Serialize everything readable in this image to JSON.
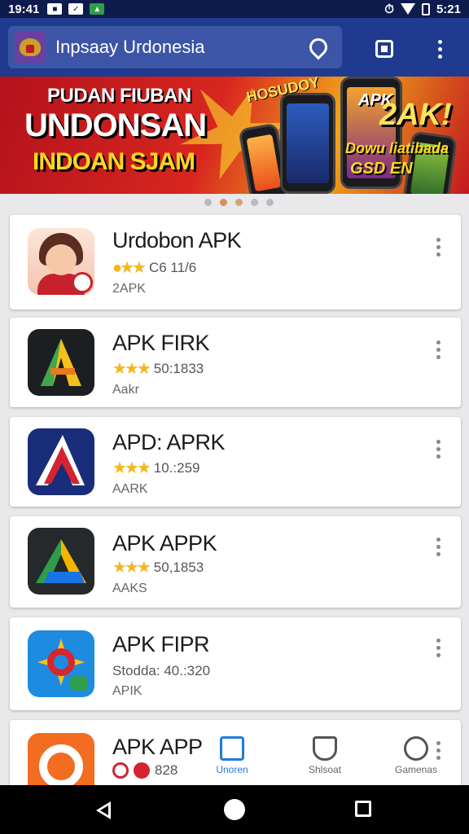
{
  "status_bar": {
    "time": "19:41",
    "right_text": "5:21"
  },
  "app_bar": {
    "title": "Inpsaay Urdonesia"
  },
  "banner": {
    "line1": "PUDAN FIUBAN",
    "line2": "UNDONSAN",
    "line3": "INDOAN SJAM",
    "tag_small": "HOSUDOY",
    "tag_apk": "APK",
    "tag_big": "2AK!",
    "tag_mid": "Dowu liatibada",
    "tag_bottom": "GSD EN"
  },
  "carousel": {
    "count": 5,
    "active_index": 1
  },
  "apps": [
    {
      "name": "Urdobon APK",
      "rating_text": "C6 11/6",
      "subtitle": "2APK",
      "rating_prefix": "●★★"
    },
    {
      "name": "APK FIRK",
      "rating_text": "50:1833",
      "subtitle": "Aakr",
      "rating_prefix": "★★★"
    },
    {
      "name": "APD: APRK",
      "rating_text": "10.:259",
      "subtitle": "AARK",
      "rating_prefix": "★★★"
    },
    {
      "name": "APK APPK",
      "rating_text": "50,1853",
      "subtitle": "AAKS",
      "rating_prefix": "★★★"
    },
    {
      "name": "APK FIPR",
      "rating_text": "Stodda: 40.:320",
      "subtitle": "APIK",
      "rating_prefix": ""
    },
    {
      "name": "APK APP",
      "rating_text": "828",
      "subtitle": "",
      "rating_prefix": ""
    }
  ],
  "bottom_nav": [
    {
      "label": "Unoren",
      "icon": "home-icon"
    },
    {
      "label": "Shlsoat",
      "icon": "shield-icon"
    },
    {
      "label": "Gamenas",
      "icon": "games-icon"
    }
  ],
  "colors": {
    "app_bar": "#1f3a8f",
    "status_bar": "#0e1b4d",
    "accent": "#1f7ae0",
    "star": "#f3b61f"
  }
}
